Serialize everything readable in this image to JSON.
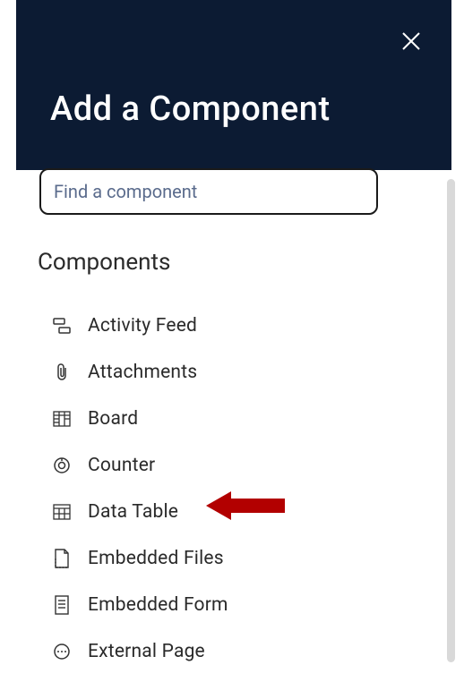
{
  "header": {
    "title": "Add a Component",
    "close_label": "Close"
  },
  "search": {
    "placeholder": "Find a component",
    "value": ""
  },
  "section": {
    "heading": "Components"
  },
  "components": [
    {
      "icon": "feed-icon",
      "label": "Activity Feed"
    },
    {
      "icon": "paperclip-icon",
      "label": "Attachments"
    },
    {
      "icon": "board-icon",
      "label": "Board"
    },
    {
      "icon": "counter-icon",
      "label": "Counter"
    },
    {
      "icon": "data-table-icon",
      "label": "Data Table"
    },
    {
      "icon": "embedded-file-icon",
      "label": "Embedded Files"
    },
    {
      "icon": "embedded-form-icon",
      "label": "Embedded Form"
    },
    {
      "icon": "external-page-icon",
      "label": "External Page"
    }
  ],
  "annotation": {
    "type": "arrow",
    "points_to": "Data Table",
    "color": "#B20000"
  }
}
